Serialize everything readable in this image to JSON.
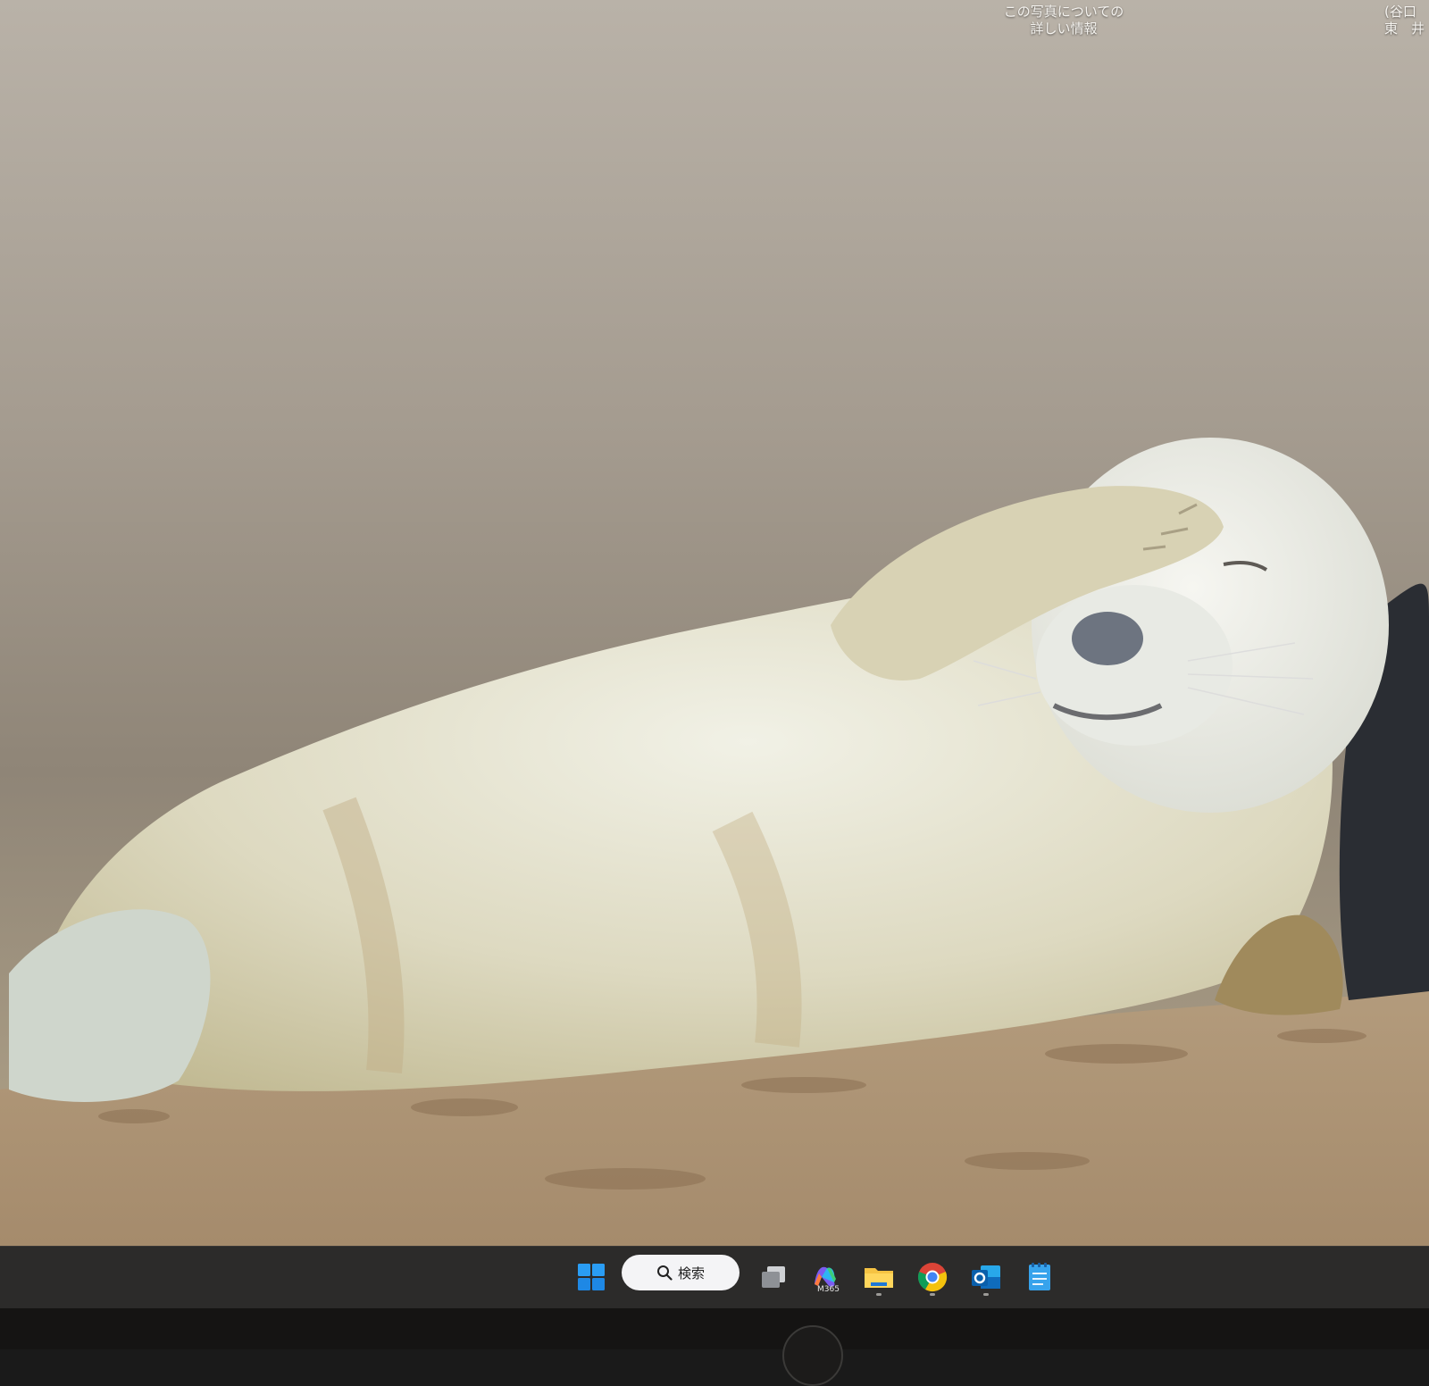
{
  "desktop": {
    "photo_info": "この写真についての\n詳しい情報",
    "photo_credit": "(谷口\n東　井"
  },
  "taskbar": {
    "search_label": "検索",
    "icons": [
      "windows-start-icon",
      "search-icon",
      "task-view-icon",
      "microsoft-365-icon",
      "file-explorer-icon",
      "chrome-icon",
      "outlook-icon",
      "notepad-icon"
    ],
    "m365_label": "M365"
  },
  "colors": {
    "taskbar": "#2c2b2a",
    "start_blue": "#1e90ff",
    "search_bg": "#f4f4f6"
  }
}
